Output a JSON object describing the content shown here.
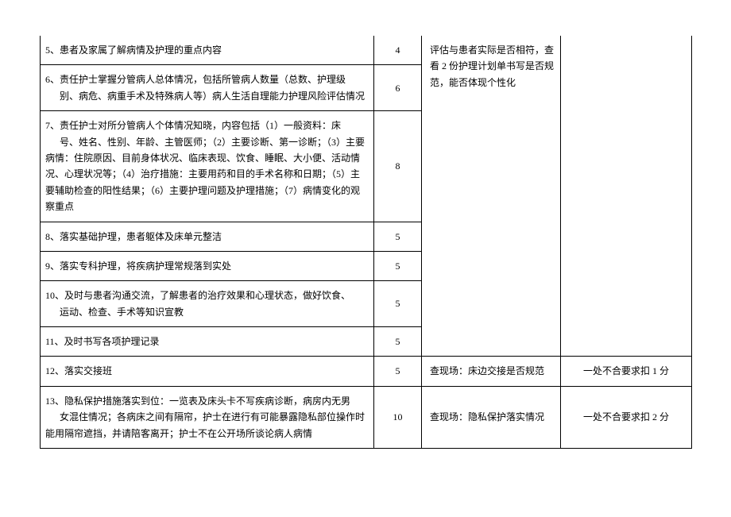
{
  "rows": [
    {
      "content": "5、患者及家属了解病情及护理的重点内容",
      "score": "4"
    },
    {
      "content_line1": "6、责任护士掌握分管病人总体情况，包括所管病人数量（总数、护理级",
      "content_line2": "别、病危、病重手术及特殊病人等）病人生活自理能力护理风险评估情况",
      "score": "6"
    },
    {
      "content_line1": "7、责任护士对所分管病人个体情况知晓，内容包括（1）一般资料：床",
      "content_line2": "号、姓名、性别、年龄、主管医师；（2）主要诊断、第一诊断；（3）主要病情：住院原因、目前身体状况、临床表现、饮食、睡眠、大小便、活动情况、心理状况等；（4）治疗措施：主要用药和目的手术名称和日期；（5）主要辅助检查的阳性结果；（6）主要护理问题及护理措施；（7）病情变化的观察重点",
      "score": "8"
    },
    {
      "content": "8、落实基础护理，患者躯体及床单元整洁",
      "score": "5"
    },
    {
      "content": "9、落实专科护理，将疾病护理常规落到实处",
      "score": "5"
    },
    {
      "content_line1": "10、及时与患者沟通交流，了解患者的治疗效果和心理状态，做好饮食、",
      "content_line2": "运动、检查、手术等知识宣教",
      "score": "5"
    },
    {
      "content": "11、及时书写各项护理记录",
      "score": "5"
    },
    {
      "content": "12、落实交接班",
      "score": "5",
      "method": "查现场：床边交接是否规范",
      "deduct": "一处不合要求扣 1 分"
    },
    {
      "content_line1": "13、隐私保护措施落实到位：一览表及床头卡不写疾病诊断，病房内无男",
      "content_line2": "女混住情况；各病床之间有隔帘，护士在进行有可能暴露隐私部位操作时能用隔帘遮挡，并请陪客离开；护士不在公开场所谈论病人病情",
      "score": "10",
      "method": "查现场：隐私保护落实情况",
      "deduct": "一处不合要求扣 2 分"
    }
  ],
  "merged_method": "评估与患者实际是否相符，查看 2 份护理计划单书写是否规范，能否体现个性化"
}
